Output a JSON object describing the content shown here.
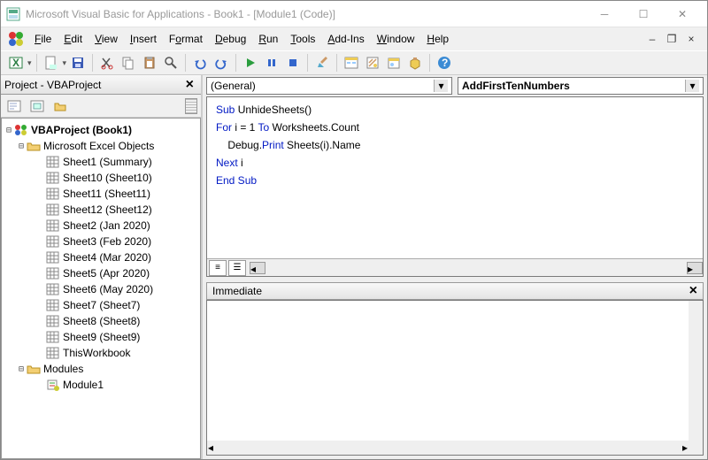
{
  "window": {
    "title": "Microsoft Visual Basic for Applications - Book1 - [Module1 (Code)]"
  },
  "menu": {
    "file": "File",
    "edit": "Edit",
    "view": "View",
    "insert": "Insert",
    "format": "Format",
    "debug": "Debug",
    "run": "Run",
    "tools": "Tools",
    "addins": "Add-Ins",
    "window": "Window",
    "help": "Help"
  },
  "project_pane": {
    "title": "Project - VBAProject"
  },
  "tree": {
    "root": "VBAProject (Book1)",
    "excel_objects": "Microsoft Excel Objects",
    "sheets": [
      "Sheet1 (Summary)",
      "Sheet10 (Sheet10)",
      "Sheet11 (Sheet11)",
      "Sheet12 (Sheet12)",
      "Sheet2 (Jan 2020)",
      "Sheet3 (Feb 2020)",
      "Sheet4 (Mar 2020)",
      "Sheet5 (Apr 2020)",
      "Sheet6 (May 2020)",
      "Sheet7 (Sheet7)",
      "Sheet8 (Sheet8)",
      "Sheet9 (Sheet9)",
      "ThisWorkbook"
    ],
    "modules_folder": "Modules",
    "module1": "Module1"
  },
  "combos": {
    "left": "(General)",
    "right": "AddFirstTenNumbers"
  },
  "code": {
    "l1a": "Sub",
    "l1b": " UnhideSheets()",
    "l2a": "For",
    "l2b": " i = 1 ",
    "l2c": "To",
    "l2d": " Worksheets.Count",
    "l3a": "    Debug.",
    "l3b": "Print",
    "l3c": " Sheets(i).Name",
    "l4a": "Next",
    "l4b": " i",
    "l5a": "End Sub"
  },
  "immediate": {
    "title": "Immediate"
  }
}
